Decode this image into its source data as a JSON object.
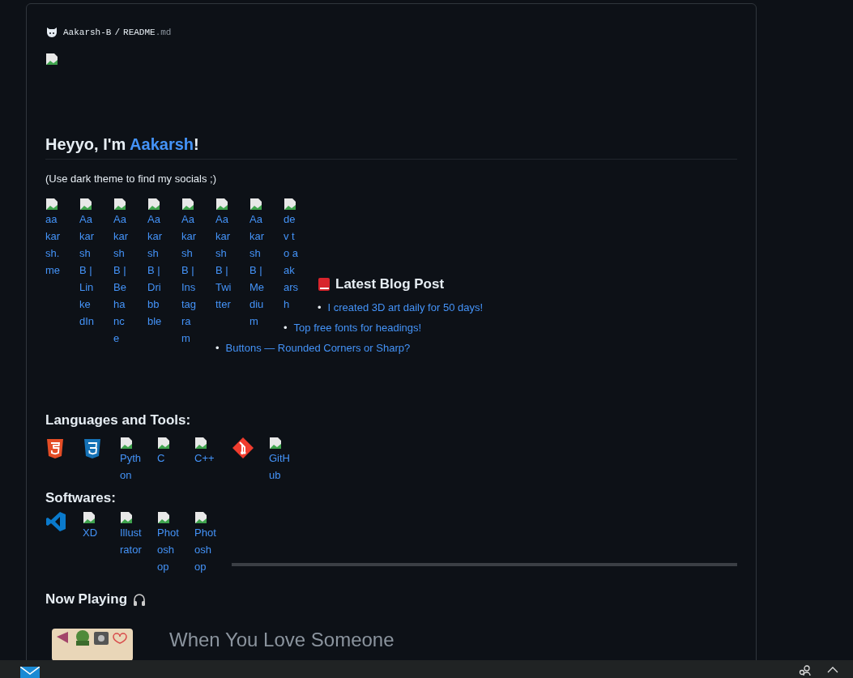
{
  "breadcrumb": {
    "owner": "Aakarsh-B",
    "separator": "/",
    "file": "README",
    "extension": ".md"
  },
  "heading": {
    "prefix": "Heyyo, I'm ",
    "name": "Aakarsh",
    "suffix": "!"
  },
  "note": "(Use dark theme to find my socials ;)",
  "socials": [
    "aakarsh.me",
    "Aakarsh B | LinkedIn",
    "Aakarsh B | Behance",
    "Aakarsh B | Dribbble",
    "Aakarsh B | Instagram",
    "Aakarsh B | Twitter",
    "Aakarsh B | Medium",
    "dev to aakarsh"
  ],
  "blog": {
    "title": "Latest Blog Post",
    "bullet": "•",
    "posts": [
      "I created 3D art daily for 50 days!",
      "Top free fonts for headings!",
      "Buttons — Rounded Corners or Sharp?"
    ]
  },
  "languages": {
    "title": "Languages and Tools:",
    "items": [
      {
        "kind": "html5"
      },
      {
        "kind": "css3"
      },
      {
        "kind": "broken",
        "alt": "Python"
      },
      {
        "kind": "broken",
        "alt": "C"
      },
      {
        "kind": "broken",
        "alt": "C++"
      },
      {
        "kind": "git"
      },
      {
        "kind": "broken",
        "alt": "GitHub"
      }
    ]
  },
  "softwares": {
    "title": "Softwares:",
    "items": [
      {
        "kind": "vscode"
      },
      {
        "kind": "broken",
        "alt": "XD"
      },
      {
        "kind": "broken",
        "alt": "Illustrator"
      },
      {
        "kind": "broken",
        "alt": "Photoshop"
      },
      {
        "kind": "broken",
        "alt": "Photoshop"
      }
    ]
  },
  "now_playing": {
    "title": "Now Playing",
    "song": "When You Love Someone"
  }
}
